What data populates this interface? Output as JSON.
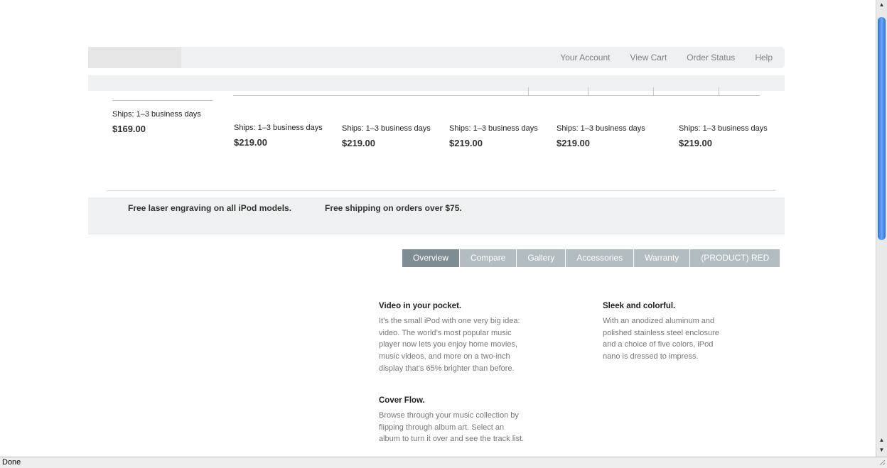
{
  "global_nav": {
    "links": [
      "Your Account",
      "View Cart",
      "Order Status",
      "Help"
    ]
  },
  "products": [
    {
      "shipping": "Ships: 1–3 business days",
      "price": "$169.00"
    },
    {
      "shipping": "Ships: 1–3 business days",
      "price": "$219.00"
    },
    {
      "shipping": "Ships: 1–3 business days",
      "price": "$219.00"
    },
    {
      "shipping": "Ships: 1–3 business days",
      "price": "$219.00"
    },
    {
      "shipping": "Ships: 1–3 business days",
      "price": "$219.00"
    },
    {
      "shipping": "Ships: 1–3 business days",
      "price": "$219.00"
    }
  ],
  "promo": {
    "engraving": "Free laser engraving on all iPod models.",
    "shipping": "Free shipping on orders over $75."
  },
  "tabs": [
    "Overview",
    "Compare",
    "Gallery",
    "Accessories",
    "Warranty",
    "(PRODUCT) RED"
  ],
  "active_tab": "Overview",
  "features": {
    "video": {
      "heading": "Video in your pocket.",
      "body": "It’s the small iPod with one very big idea: video. The world’s most popular music player now lets you enjoy home movies, music videos, and more on a two-inch display that’s 65% brighter than before."
    },
    "coverflow": {
      "heading": "Cover Flow.",
      "body": "Browse through your music collection by flipping through album art. Select an album to turn it over and see the track list."
    },
    "sleek": {
      "heading": "Sleek and colorful.",
      "body": "With an anodized aluminum and polished stainless steel enclosure and a choice of five colors, iPod nano is dressed to impress."
    }
  },
  "status_bar": {
    "text": "Done"
  },
  "colors": {
    "nav_bg": "#eef0f1",
    "tab_bg": "#b3bcc1",
    "tab_active_bg": "#7f8c94",
    "scroll_thumb": "#2c6fd6"
  }
}
